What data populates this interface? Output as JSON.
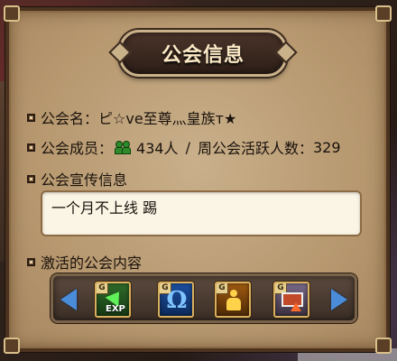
{
  "window": {
    "title": "公会信息"
  },
  "guild": {
    "name_label": "公会名：",
    "name_value": "ピ☆ve至尊灬皇族ᴛ★",
    "members_label": "公会成员：",
    "members_value": "434人",
    "separator": "/",
    "weekly_active_label": "周公会活跃人数：",
    "weekly_active_value": "329",
    "notice_label": "公会宣传信息",
    "notice_text": "一个月不上线  踢",
    "content_label": "激活的公会内容"
  },
  "skills": [
    {
      "icon": "exp-boost-icon",
      "tag": "G",
      "label": "EXP"
    },
    {
      "icon": "omega-rune-icon",
      "tag": "G",
      "symbol": "Ω"
    },
    {
      "icon": "golden-body-icon",
      "tag": "G"
    },
    {
      "icon": "skill-book-icon",
      "tag": "G"
    }
  ],
  "colors": {
    "panel": "#b7986f",
    "title_plate": "#2c1e17",
    "title_text": "#fbe9c6",
    "member_icon": "#2e8a2a",
    "nav_arrow": "#4a8cd8"
  }
}
